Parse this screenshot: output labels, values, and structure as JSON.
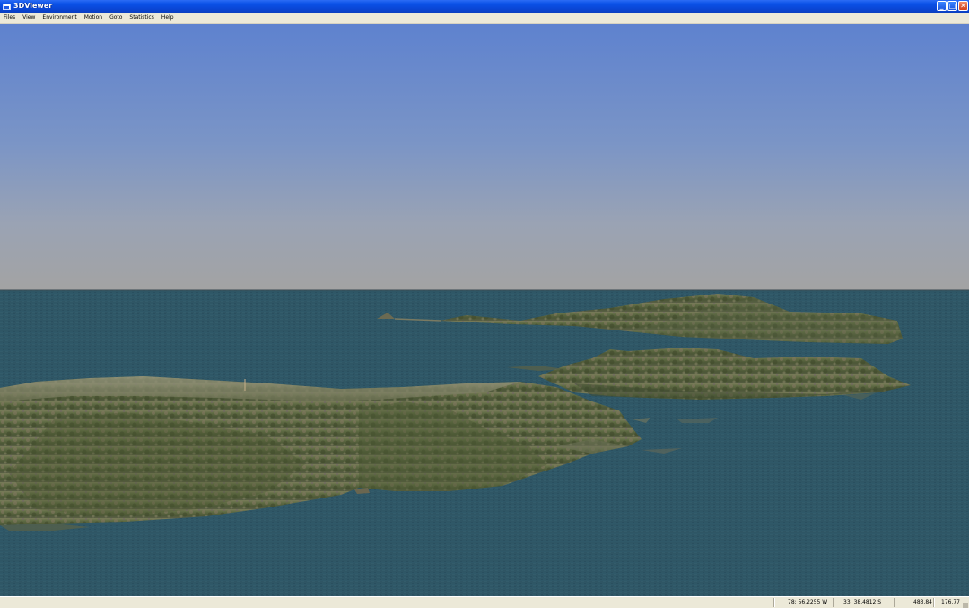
{
  "window": {
    "title": "3DViewer",
    "controls": {
      "minimize": "_",
      "maximize": "□",
      "close": "✕"
    }
  },
  "menu": {
    "items": [
      "Files",
      "View",
      "Environment",
      "Motion",
      "Goto",
      "Statistics",
      "Help"
    ]
  },
  "viewport": {
    "sky_top_color": "#5e82cf",
    "sky_horizon_color": "#a3a3a3",
    "water_color": "#2e5566",
    "terrain_color": "#5b6a46"
  },
  "status": {
    "longitude": "78: 56.2255 W",
    "latitude": "33: 38.4812 S",
    "value1": "483.84",
    "value2": "176.77"
  }
}
